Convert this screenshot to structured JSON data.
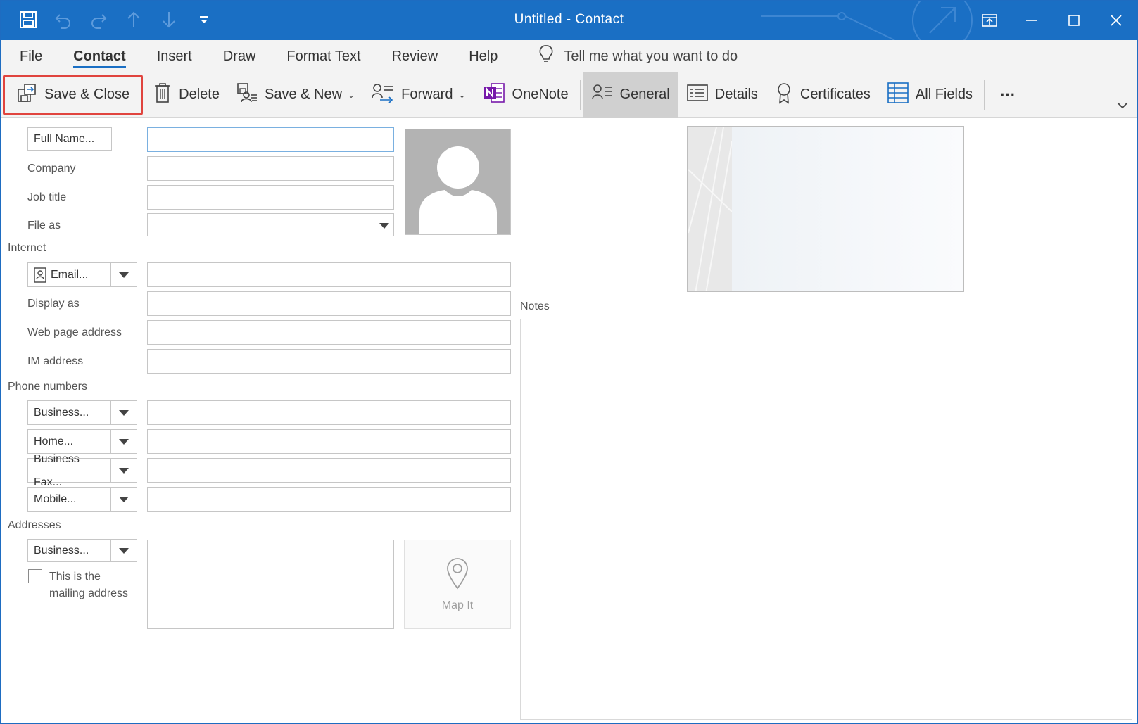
{
  "window": {
    "title": "Untitled  -  Contact"
  },
  "quick_access": {
    "icons": [
      "save-icon",
      "undo-icon",
      "redo-icon",
      "up-arrow-icon",
      "down-arrow-icon",
      "customize-icon"
    ]
  },
  "menu": {
    "items": [
      "File",
      "Contact",
      "Insert",
      "Draw",
      "Format Text",
      "Review",
      "Help"
    ],
    "active": "Contact",
    "tell_me": "Tell me what you want to do"
  },
  "ribbon": {
    "save_close": "Save & Close",
    "delete": "Delete",
    "save_new": "Save & New",
    "forward": "Forward",
    "onenote": "OneNote",
    "general": "General",
    "details": "Details",
    "certificates": "Certificates",
    "all_fields": "All Fields",
    "more": "···"
  },
  "form": {
    "full_name_button": "Full Name...",
    "company_label": "Company",
    "job_title_label": "Job title",
    "file_as_label": "File as",
    "internet_section": "Internet",
    "email_button": "Email...",
    "display_as_label": "Display as",
    "web_page_label": "Web page address",
    "im_label": "IM address",
    "phone_section": "Phone numbers",
    "phone_business": "Business...",
    "phone_home": "Home...",
    "phone_fax": "Business Fax...",
    "phone_mobile": "Mobile...",
    "addresses_section": "Addresses",
    "address_type": "Business...",
    "mailing_line1": "This is the",
    "mailing_line2": "mailing address",
    "map_it": "Map It",
    "notes_label": "Notes",
    "values": {
      "full_name": "",
      "company": "",
      "job_title": "",
      "file_as": "",
      "email": "",
      "display_as": "",
      "web_page": "",
      "im": "",
      "phone_business": "",
      "phone_home": "",
      "phone_fax": "",
      "phone_mobile": "",
      "address": "",
      "notes": ""
    },
    "mailing_checked": false
  },
  "colors": {
    "title_bar": "#1a6fc4",
    "ribbon_bg": "#f3f3f3",
    "highlight": "#e0443e",
    "selected_tab": "#d0d0d0",
    "onenote": "#7719aa"
  }
}
